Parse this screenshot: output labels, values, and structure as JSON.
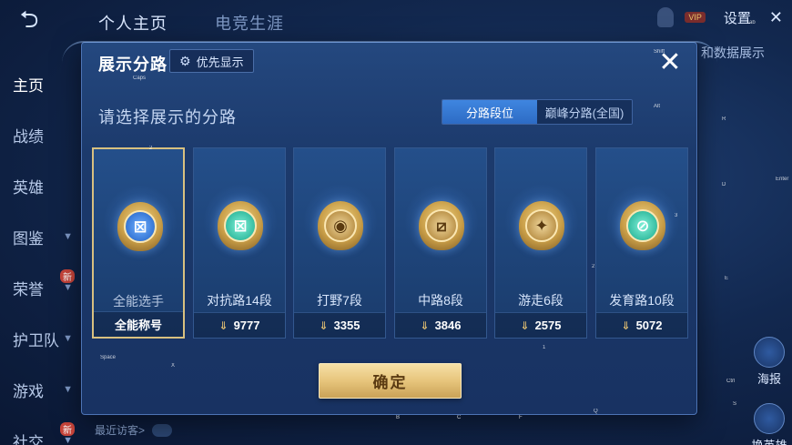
{
  "background": {
    "tabs": [
      "个人主页",
      "电竞生涯"
    ],
    "sidebar": [
      {
        "label": "主页",
        "arrow": false,
        "badge": ""
      },
      {
        "label": "战绩",
        "arrow": false,
        "badge": ""
      },
      {
        "label": "英雄",
        "arrow": false,
        "badge": ""
      },
      {
        "label": "图鉴",
        "arrow": true,
        "badge": ""
      },
      {
        "label": "荣誉",
        "arrow": true,
        "badge": "新"
      },
      {
        "label": "护卫队",
        "arrow": true,
        "badge": ""
      },
      {
        "label": "游戏",
        "arrow": true,
        "badge": ""
      },
      {
        "label": "社交",
        "arrow": true,
        "badge": "新"
      }
    ],
    "vip_label": "VIP",
    "settings_label": "设置",
    "right_text": "和数据展示",
    "right_icons": [
      {
        "label": "海报",
        "icon": "poster-icon"
      },
      {
        "label": "换英雄",
        "icon": "swap-hero-icon"
      }
    ],
    "bottom_text": "最近访客>"
  },
  "modal": {
    "title": "展示分路",
    "pref_button": "优先显示",
    "subtitle": "请选择展示的分路",
    "segments": [
      {
        "label": "分路段位",
        "active": true
      },
      {
        "label": "巅峰分路(全国)",
        "active": false
      }
    ],
    "cards": [
      {
        "name": "全能选手",
        "value": "全能称号",
        "icon": "all-rounder-icon",
        "style": "blue",
        "glyph": "⊠",
        "selected": true,
        "arrow": false
      },
      {
        "name": "对抗路14段",
        "value": "9777",
        "icon": "clash-lane-icon",
        "style": "green",
        "glyph": "⊠",
        "selected": false,
        "arrow": true
      },
      {
        "name": "打野7段",
        "value": "3355",
        "icon": "jungle-icon",
        "style": "gold",
        "glyph": "◉",
        "selected": false,
        "arrow": true
      },
      {
        "name": "中路8段",
        "value": "3846",
        "icon": "mid-lane-icon",
        "style": "gold",
        "glyph": "⧄",
        "selected": false,
        "arrow": true
      },
      {
        "name": "游走6段",
        "value": "2575",
        "icon": "roam-icon",
        "style": "gold",
        "glyph": "✦",
        "selected": false,
        "arrow": true
      },
      {
        "name": "发育路10段",
        "value": "5072",
        "icon": "farm-lane-icon",
        "style": "green",
        "glyph": "⊘",
        "selected": false,
        "arrow": true
      }
    ],
    "confirm_label": "确定"
  },
  "key_hints": {
    "caps": "Caps",
    "tab": "Tab",
    "shift": "Shift",
    "alt": "Alt",
    "r": "R",
    "d": "D",
    "enter": "Enter",
    "three": "3",
    "two_a": "2",
    "two_b": "2",
    "e": "E",
    "x": "X",
    "one": "1",
    "s": "S",
    "b": "B",
    "c": "C",
    "f": "F",
    "q": "Q",
    "space": "Space",
    "ctrl": "Ctrl"
  }
}
